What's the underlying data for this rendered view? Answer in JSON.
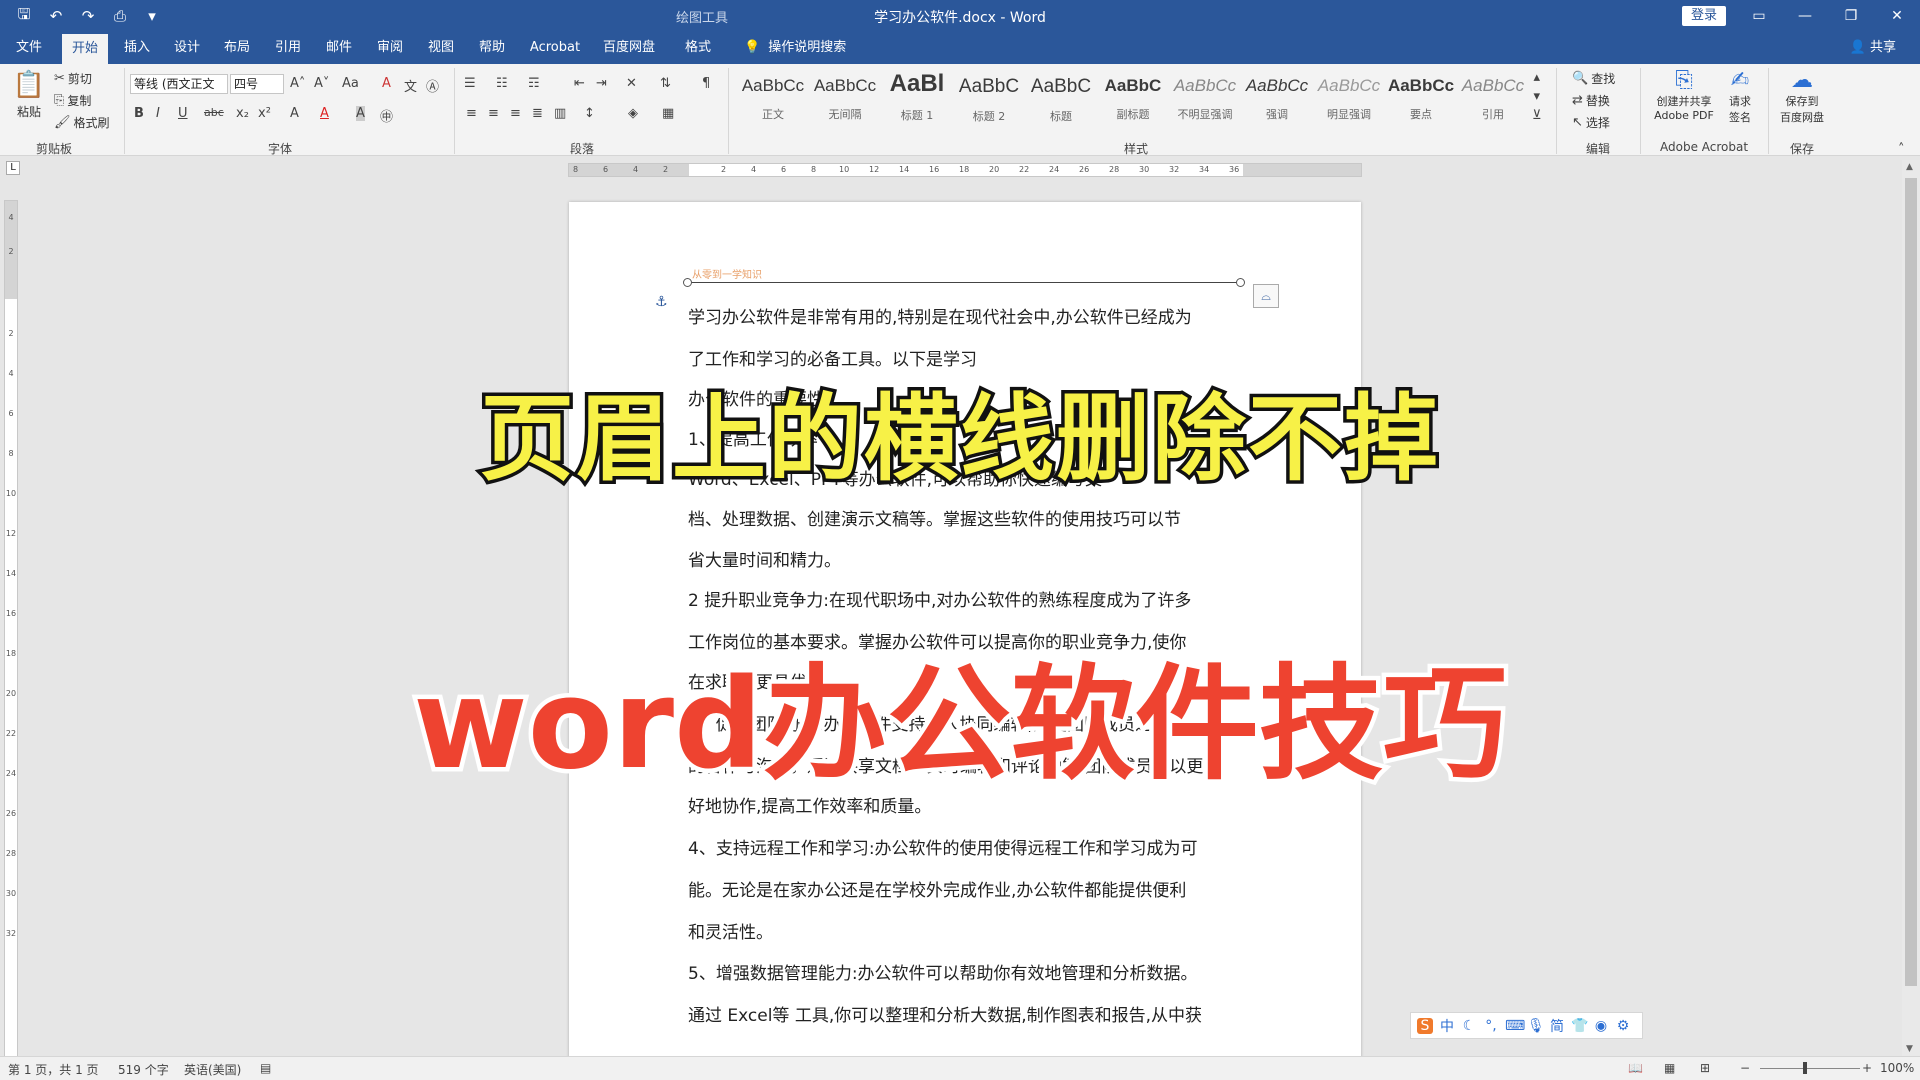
{
  "title_bar": {
    "doc_title": "学习办公软件.docx - Word",
    "context_tools": "绘图工具",
    "login": "登录",
    "icons": [
      "save-icon",
      "undo-icon",
      "redo-icon",
      "print-preview-icon",
      "customize-qat-icon"
    ]
  },
  "tabs": [
    "文件",
    "开始",
    "插入",
    "设计",
    "布局",
    "引用",
    "邮件",
    "审阅",
    "视图",
    "帮助",
    "Acrobat",
    "百度网盘",
    "格式"
  ],
  "active_tab": "开始",
  "tell_me": "操作说明搜索",
  "share": "共享",
  "ribbon": {
    "clipboard": {
      "paste": "粘贴",
      "cut": "剪切",
      "copy": "复制",
      "format_painter": "格式刷",
      "label": "剪贴板"
    },
    "font": {
      "font_name": "等线 (西文正文",
      "font_size": "四号",
      "label": "字体"
    },
    "paragraph": {
      "label": "段落"
    },
    "styles": {
      "label": "样式",
      "items": [
        {
          "sample": "AaBbCc",
          "name": "正文"
        },
        {
          "sample": "AaBbCc",
          "name": "无间隔"
        },
        {
          "sample": "AaBl",
          "name": "标题 1"
        },
        {
          "sample": "AaBbC",
          "name": "标题 2"
        },
        {
          "sample": "AaBbC",
          "name": "标题"
        },
        {
          "sample": "AaBbC",
          "name": "副标题"
        },
        {
          "sample": "AaBbCc",
          "name": "不明显强调"
        },
        {
          "sample": "AaBbCc",
          "name": "强调"
        },
        {
          "sample": "AaBbCc",
          "name": "明显强调"
        },
        {
          "sample": "AaBbCc",
          "name": "要点"
        },
        {
          "sample": "AaBbCc",
          "name": "引用"
        }
      ]
    },
    "editing": {
      "find": "查找",
      "replace": "替换",
      "select": "选择",
      "label": "编辑"
    },
    "acrobat": {
      "create_share_line1": "创建并共享",
      "create_share_line2": "Adobe PDF",
      "request_line1": "请求",
      "request_line2": "签名",
      "label": "Adobe Acrobat"
    },
    "save": {
      "line1": "保存到",
      "line2": "百度网盘",
      "label": "保存"
    }
  },
  "ruler": {
    "h_numbers": [
      "8",
      "6",
      "4",
      "2",
      "2",
      "4",
      "6",
      "8",
      "10",
      "12",
      "14",
      "16",
      "18",
      "20",
      "22",
      "24",
      "26",
      "28",
      "30",
      "32",
      "34",
      "36"
    ],
    "v_numbers": [
      "4",
      "2",
      "2",
      "4",
      "6",
      "8",
      "10",
      "12",
      "14",
      "16",
      "18",
      "20",
      "22",
      "24",
      "26",
      "28",
      "30",
      "32"
    ]
  },
  "document": {
    "header_text": "从零到一学知识",
    "paragraphs": [
      "学习办公软件是非常有用的,特别是在现代社会中,办公软件已经成为",
      "了工作和学习的必备工具。以下是学习",
      "办公软件的重要性:",
      "1、提高工作效率",
      "Word、Excel、PPT等办公软件,可以帮助你快速编写文",
      "档、处理数据、创建演示文稿等。掌握这些软件的使用技巧可以节",
      "省大量时间和精力。",
      "2 提升职业竞争力:在现代职场中,对办公软件的熟练程度成为了许多",
      "工作岗位的基本要求。掌握办公软件可以提高你的职业竞争力,使你",
      "在求职中更具优势。",
      "3、促进团队协作:办公软件支持多人协同编辑,方便团队成员之间",
      "的合作与沟通。通过共享文档、实时编辑和评论功能,团队成员可以更",
      "好地协作,提高工作效率和质量。",
      "4、支持远程工作和学习:办公软件的使用使得远程工作和学习成为可",
      "能。无论是在家办公还是在学校外完成作业,办公软件都能提供便利",
      "和灵活性。",
      "5、增强数据管理能力:办公软件可以帮助你有效地管理和分析数据。",
      "通过 Excel等 工具,你可以整理和分析大数据,制作图表和报告,从中获"
    ]
  },
  "overlay": {
    "title": "页眉上的横线删除不掉",
    "subtitle": "word办公软件技巧",
    "title_color": "#f7f147",
    "subtitle_color": "#ee4330"
  },
  "ime": {
    "items": [
      "sogou-logo-icon",
      "中",
      "moon-icon",
      "punct-icon",
      "keyboard-icon",
      "voice-icon",
      "简",
      "shirt-icon",
      "skin-icon",
      "settings-icon"
    ]
  },
  "status_bar": {
    "page": "第 1 页，共 1 页",
    "words": "519 个字",
    "language": "英语(美国)",
    "zoom": "100%"
  },
  "colors": {
    "accent": "#2b579a",
    "ribbon": "#f3f3f3"
  }
}
